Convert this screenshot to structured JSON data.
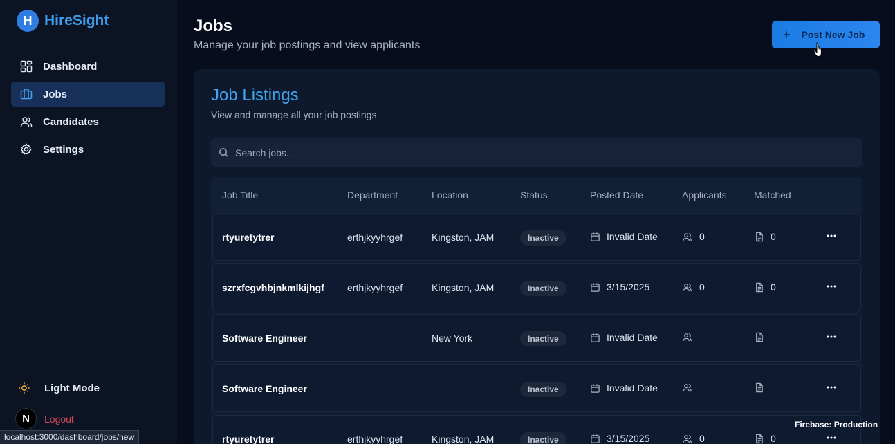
{
  "brand": {
    "logo_letter": "H",
    "name": "HireSight"
  },
  "sidebar": {
    "items": [
      {
        "label": "Dashboard",
        "icon": "dashboard-grid-icon",
        "active": false
      },
      {
        "label": "Jobs",
        "icon": "briefcase-icon",
        "active": true
      },
      {
        "label": "Candidates",
        "icon": "users-icon",
        "active": false
      },
      {
        "label": "Settings",
        "icon": "gear-icon",
        "active": false
      }
    ],
    "mode_label": "Light Mode",
    "logout_label": "Logout",
    "logout_avatar": "N"
  },
  "header": {
    "title": "Jobs",
    "subtitle": "Manage your job postings and view applicants",
    "post_button": "Post New Job"
  },
  "listing": {
    "title": "Job Listings",
    "subtitle": "View and manage all your job postings",
    "search_placeholder": "Search jobs...",
    "columns": [
      "Job Title",
      "Department",
      "Location",
      "Status",
      "Posted Date",
      "Applicants",
      "Matched"
    ],
    "rows": [
      {
        "title": "rtyuretytrer",
        "department": "erthjkyyhrgef",
        "location": "Kingston, JAM",
        "status": "Inactive",
        "posted": "Invalid Date",
        "applicants": "0",
        "matched": "0"
      },
      {
        "title": "szrxfcgvhbjnkmlkijhgf",
        "department": "erthjkyyhrgef",
        "location": "Kingston, JAM",
        "status": "Inactive",
        "posted": "3/15/2025",
        "applicants": "0",
        "matched": "0"
      },
      {
        "title": "Software Engineer",
        "department": "",
        "location": "New York",
        "status": "Inactive",
        "posted": "Invalid Date",
        "applicants": "",
        "matched": ""
      },
      {
        "title": "Software Engineer",
        "department": "",
        "location": "",
        "status": "Inactive",
        "posted": "Invalid Date",
        "applicants": "",
        "matched": ""
      },
      {
        "title": "rtyuretytrer",
        "department": "erthjkyyhrgef",
        "location": "Kingston, JAM",
        "status": "Inactive",
        "posted": "3/15/2025",
        "applicants": "0",
        "matched": "0"
      }
    ]
  },
  "status_bar_url": "localhost:3000/dashboard/jobs/new",
  "environment_label": "Firebase: Production",
  "colors": {
    "accent": "#3d9be9",
    "button": "#1a7ce3",
    "active_nav": "#17305a",
    "logout": "#d0485a"
  }
}
